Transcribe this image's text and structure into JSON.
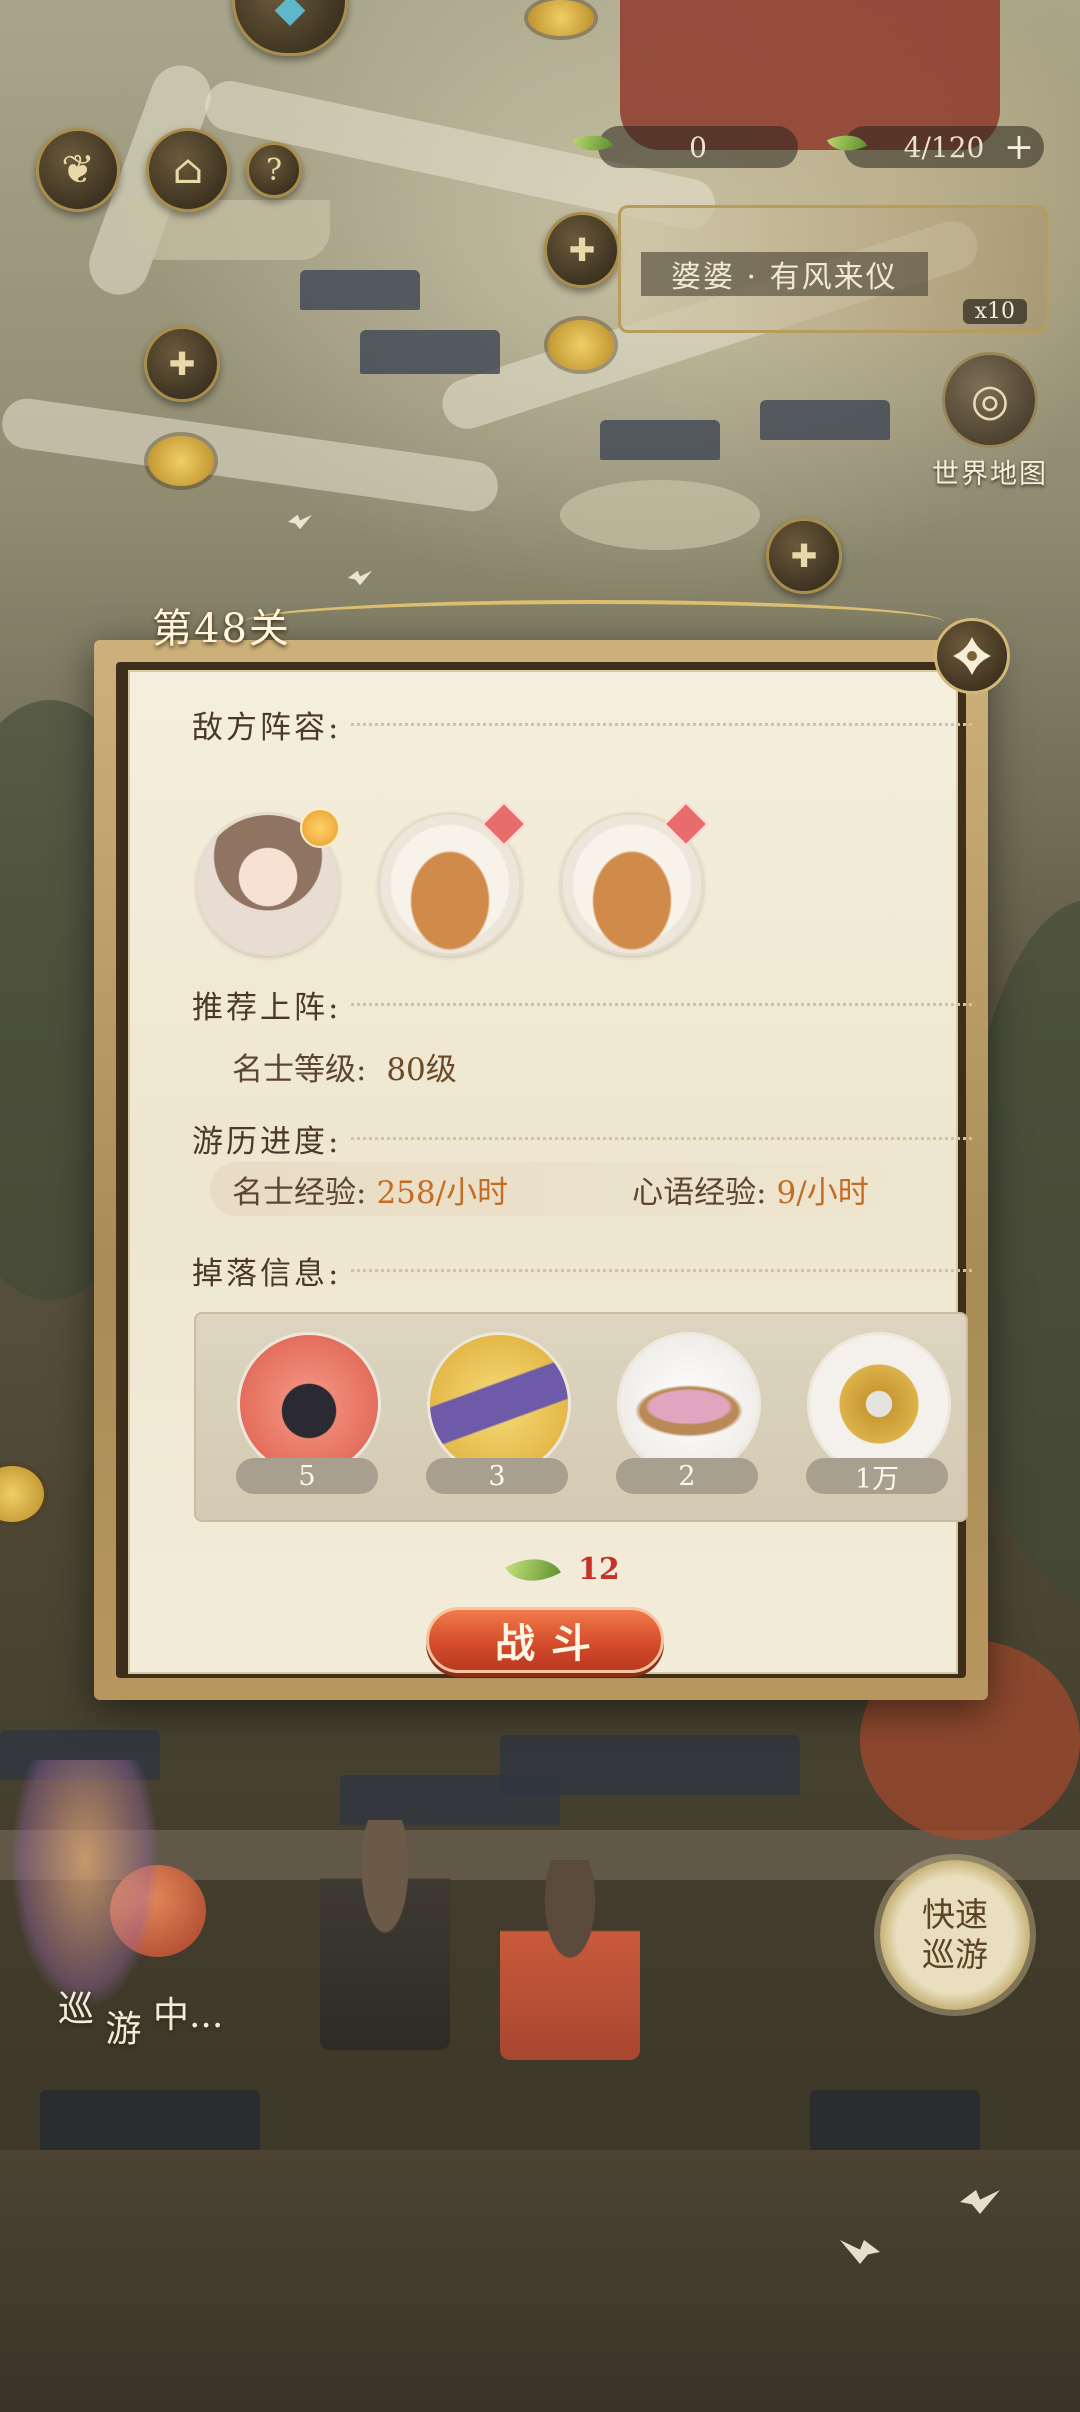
{
  "resources": {
    "res1_value": "0",
    "res2_value": "4/120",
    "plus_label": "+"
  },
  "event_banner": {
    "title": "婆婆 · 有风来仪",
    "count": "x10"
  },
  "world_map": {
    "label": "世界地图"
  },
  "quick_tour": {
    "line1": "快速",
    "line2": "巡游"
  },
  "touring": {
    "c1": "巡",
    "c2": "游",
    "c3": "中..."
  },
  "dialog": {
    "stage_title": "第48关",
    "enemy_label": "敌方阵容:",
    "enemies": [
      {
        "name": "character-avatar",
        "badge": "moon"
      },
      {
        "name": "deer-avatar",
        "badge": "diamond"
      },
      {
        "name": "deer-avatar",
        "badge": "diamond"
      }
    ],
    "recommend_label": "推荐上阵:",
    "level_label": "名士等级:",
    "level_value": "80级",
    "progress_label": "游历进度:",
    "exp1_label": "名士经验:",
    "exp1_value": "258/小时",
    "exp2_label": "心语经验:",
    "exp2_value": "9/小时",
    "drops_label": "掉落信息:",
    "drops": [
      {
        "icon": "gift-box-icon",
        "qty": "5"
      },
      {
        "icon": "book-scroll-icon",
        "qty": "3"
      },
      {
        "icon": "petal-bowl-icon",
        "qty": "2"
      },
      {
        "icon": "copper-coin-icon",
        "qty": "1万"
      }
    ],
    "cost": "12",
    "battle_label": "战斗"
  }
}
